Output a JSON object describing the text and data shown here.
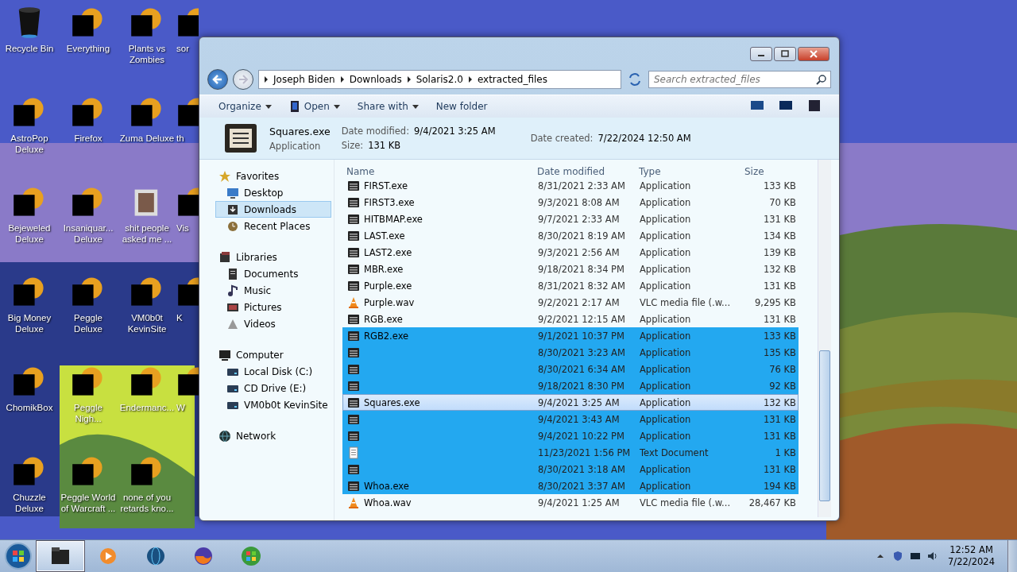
{
  "desktop_icons": [
    {
      "label": "Recycle Bin",
      "kind": "bin",
      "redacted": false
    },
    {
      "label": "Everything",
      "kind": "app",
      "redacted": true
    },
    {
      "label": "Plants vs Zombies",
      "kind": "app",
      "redacted": true
    },
    {
      "label": "sor",
      "kind": "app",
      "redacted": true
    },
    {
      "label": "AstroPop Deluxe",
      "kind": "app",
      "redacted": true
    },
    {
      "label": "Firefox",
      "kind": "app",
      "redacted": true
    },
    {
      "label": "Zuma Deluxe",
      "kind": "app",
      "redacted": true
    },
    {
      "label": "th",
      "kind": "app",
      "redacted": true
    },
    {
      "label": "Bejeweled Deluxe",
      "kind": "app",
      "redacted": true
    },
    {
      "label": "Insaniquar... Deluxe",
      "kind": "app",
      "redacted": true
    },
    {
      "label": "shit people asked me ...",
      "kind": "folder",
      "redacted": false
    },
    {
      "label": "Vis",
      "kind": "app",
      "redacted": true
    },
    {
      "label": "Big Money Deluxe",
      "kind": "app",
      "redacted": true
    },
    {
      "label": "Peggle Deluxe",
      "kind": "app",
      "redacted": true
    },
    {
      "label": "VM0b0t KevinSite",
      "kind": "app",
      "redacted": true
    },
    {
      "label": "K",
      "kind": "app",
      "redacted": true
    },
    {
      "label": "ChomikBox",
      "kind": "app",
      "redacted": true
    },
    {
      "label": "Peggle Nigh...",
      "kind": "app",
      "redacted": true
    },
    {
      "label": "Endermanc...",
      "kind": "app",
      "redacted": true
    },
    {
      "label": "W",
      "kind": "app",
      "redacted": true
    },
    {
      "label": "Chuzzle Deluxe",
      "kind": "app",
      "redacted": true
    },
    {
      "label": "Peggle World of Warcraft ...",
      "kind": "app",
      "redacted": true
    },
    {
      "label": "none of you retards kno...",
      "kind": "app",
      "redacted": true
    }
  ],
  "explorer": {
    "breadcrumb": [
      "Joseph Biden",
      "Downloads",
      "Solaris2.0",
      "extracted_files"
    ],
    "search": {
      "placeholder": "Search extracted_files"
    },
    "toolbar": [
      {
        "label": "Organize",
        "dropdown": true
      },
      {
        "label": "Open",
        "dropdown": true
      },
      {
        "label": "Share with",
        "dropdown": true
      },
      {
        "label": "New folder",
        "dropdown": false
      }
    ],
    "details": {
      "name": "Squares.exe",
      "type": "Application",
      "modified_label": "Date modified:",
      "modified": "9/4/2021 3:25 AM",
      "size_label": "Size:",
      "size": "131 KB",
      "created_label": "Date created:",
      "created": "7/22/2024 12:50 AM"
    },
    "nav": [
      {
        "label": "Favorites",
        "kind": "star",
        "children": [
          {
            "label": "Desktop",
            "kind": "desktop",
            "selected": false
          },
          {
            "label": "Downloads",
            "kind": "downloads",
            "selected": true
          },
          {
            "label": "Recent Places",
            "kind": "recent",
            "selected": false
          }
        ]
      },
      {
        "label": "Libraries",
        "kind": "library",
        "children": [
          {
            "label": "Documents",
            "kind": "documents",
            "selected": false
          },
          {
            "label": "Music",
            "kind": "music",
            "selected": false
          },
          {
            "label": "Pictures",
            "kind": "pictures",
            "selected": false
          },
          {
            "label": "Videos",
            "kind": "videos",
            "selected": false
          }
        ]
      },
      {
        "label": "Computer",
        "kind": "computer",
        "children": [
          {
            "label": "Local Disk (C:)",
            "kind": "disk",
            "selected": false
          },
          {
            "label": "CD Drive (E:)",
            "kind": "disk",
            "selected": false
          },
          {
            "label": "VM0b0t KevinSite",
            "kind": "disk",
            "selected": false
          }
        ]
      },
      {
        "label": "Network",
        "kind": "network"
      }
    ],
    "columns": [
      "Name",
      "Date modified",
      "Type",
      "Size"
    ],
    "files": [
      {
        "name": "FIRST.exe",
        "kind": "exe",
        "modified": "8/31/2021 2:33 AM",
        "type": "Application",
        "size": "133 KB",
        "selected": false,
        "focused": false
      },
      {
        "name": "FIRST3.exe",
        "kind": "exe",
        "modified": "9/3/2021 8:08 AM",
        "type": "Application",
        "size": "70 KB",
        "selected": false,
        "focused": false
      },
      {
        "name": "HITBMAP.exe",
        "kind": "exe",
        "modified": "9/7/2021 2:33 AM",
        "type": "Application",
        "size": "131 KB",
        "selected": false,
        "focused": false
      },
      {
        "name": "LAST.exe",
        "kind": "exe",
        "modified": "8/30/2021 8:19 AM",
        "type": "Application",
        "size": "134 KB",
        "selected": false,
        "focused": false
      },
      {
        "name": "LAST2.exe",
        "kind": "exe",
        "modified": "9/3/2021 2:56 AM",
        "type": "Application",
        "size": "139 KB",
        "selected": false,
        "focused": false
      },
      {
        "name": "MBR.exe",
        "kind": "exe",
        "modified": "9/18/2021 8:34 PM",
        "type": "Application",
        "size": "132 KB",
        "selected": false,
        "focused": false
      },
      {
        "name": "Purple.exe",
        "kind": "exe",
        "modified": "8/31/2021 8:32 AM",
        "type": "Application",
        "size": "131 KB",
        "selected": false,
        "focused": false
      },
      {
        "name": "Purple.wav",
        "kind": "wav",
        "modified": "9/2/2021 2:17 AM",
        "type": "VLC media file (.w...",
        "size": "9,295 KB",
        "selected": false,
        "focused": false
      },
      {
        "name": "RGB.exe",
        "kind": "exe",
        "modified": "9/2/2021 12:15 AM",
        "type": "Application",
        "size": "131 KB",
        "selected": false,
        "focused": false
      },
      {
        "name": "RGB2.exe",
        "kind": "exe",
        "modified": "9/1/2021 10:37 PM",
        "type": "Application",
        "size": "133 KB",
        "selected": true,
        "focused": false
      },
      {
        "kind": "exe",
        "modified": "8/30/2021 3:23 AM",
        "type": "Application",
        "size": "135 KB",
        "selected": true,
        "focused": false
      },
      {
        "kind": "exe",
        "modified": "8/30/2021 6:34 AM",
        "type": "Application",
        "size": "76 KB",
        "selected": true,
        "focused": false
      },
      {
        "kind": "exe",
        "modified": "9/18/2021 8:30 PM",
        "type": "Application",
        "size": "92 KB",
        "selected": true,
        "focused": false
      },
      {
        "name": "Squares.exe",
        "kind": "exe",
        "modified": "9/4/2021 3:25 AM",
        "type": "Application",
        "size": "132 KB",
        "selected": true,
        "focused": true
      },
      {
        "kind": "exe",
        "modified": "9/4/2021 3:43 AM",
        "type": "Application",
        "size": "131 KB",
        "selected": true,
        "focused": false
      },
      {
        "kind": "exe",
        "modified": "9/4/2021 10:22 PM",
        "type": "Application",
        "size": "131 KB",
        "selected": true,
        "focused": false
      },
      {
        "kind": "txt",
        "modified": "11/23/2021 1:56 PM",
        "type": "Text Document",
        "size": "1 KB",
        "selected": true,
        "focused": false
      },
      {
        "kind": "exe",
        "modified": "8/30/2021 3:18 AM",
        "type": "Application",
        "size": "131 KB",
        "selected": true,
        "focused": false
      },
      {
        "name": "Whoa.exe",
        "kind": "exe",
        "modified": "8/30/2021 3:37 AM",
        "type": "Application",
        "size": "194 KB",
        "selected": true,
        "focused": false
      },
      {
        "name": "Whoa.wav",
        "kind": "wav",
        "modified": "9/4/2021 1:25 AM",
        "type": "VLC media file (.w...",
        "size": "28,467 KB",
        "selected": false,
        "focused": false
      }
    ]
  },
  "taskbar": {
    "items": [
      {
        "kind": "explorer",
        "active": true
      },
      {
        "kind": "media",
        "active": false
      },
      {
        "kind": "globe",
        "active": false
      },
      {
        "kind": "firefox",
        "active": false
      },
      {
        "kind": "windows",
        "active": false
      }
    ],
    "time": "12:52 AM",
    "date": "7/22/2024"
  }
}
